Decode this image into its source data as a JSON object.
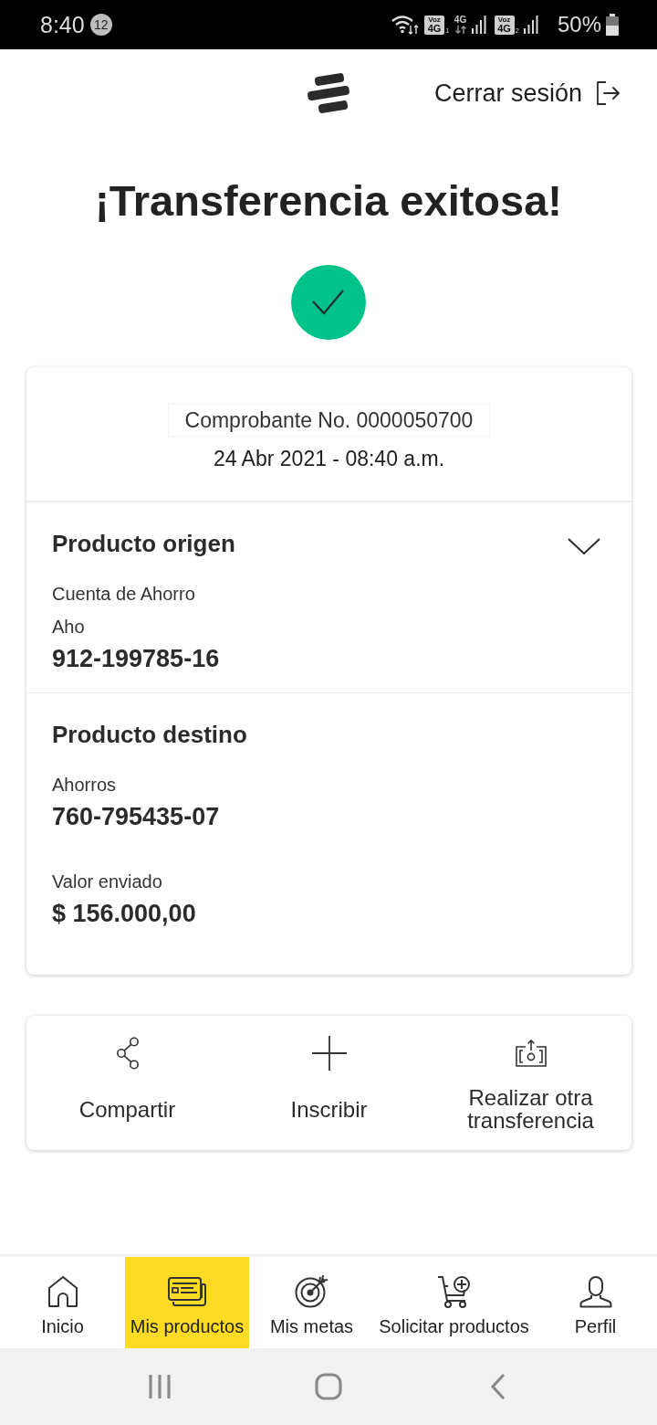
{
  "status_bar": {
    "time": "8:40",
    "notification_count": "12",
    "sims": [
      {
        "top": "Voz",
        "bottom": "4G",
        "index": "1",
        "data": "4G"
      },
      {
        "top": "Voz",
        "bottom": "4G",
        "index": "2"
      }
    ],
    "battery": "50%"
  },
  "header": {
    "logout": "Cerrar sesión"
  },
  "title": "¡Transferencia exitosa!",
  "receipt": {
    "number": "Comprobante No. 0000050700",
    "date": "24 Abr 2021 - 08:40 a.m."
  },
  "sections": [
    {
      "title": "Producto origen",
      "toggle": true,
      "lines": [
        {
          "kind": "label",
          "text": "Cuenta de Ahorro"
        },
        {
          "kind": "label",
          "text": "Aho"
        },
        {
          "kind": "value",
          "text": "912-199785-16"
        }
      ]
    },
    {
      "title": "Producto destino",
      "toggle": false,
      "lines": [
        {
          "kind": "label",
          "text": "Ahorros"
        },
        {
          "kind": "value",
          "text": "760-795435-07"
        },
        {
          "kind": "label",
          "text": "Valor enviado"
        },
        {
          "kind": "value",
          "text": "$ 156.000,00"
        }
      ]
    }
  ],
  "actions": [
    {
      "kind": "share",
      "label": "Compartir"
    },
    {
      "kind": "add",
      "label": "Inscribir"
    },
    {
      "kind": "transfer",
      "label": "Realizar otra transferencia"
    }
  ],
  "nav": [
    {
      "kind": "home",
      "label": "Inicio",
      "selected": false
    },
    {
      "kind": "cards",
      "label": "Mis productos",
      "selected": true
    },
    {
      "kind": "target",
      "label": "Mis metas",
      "selected": false
    },
    {
      "kind": "cart",
      "label": "Solicitar productos",
      "selected": false
    },
    {
      "kind": "person",
      "label": "Perfil",
      "selected": false
    }
  ]
}
